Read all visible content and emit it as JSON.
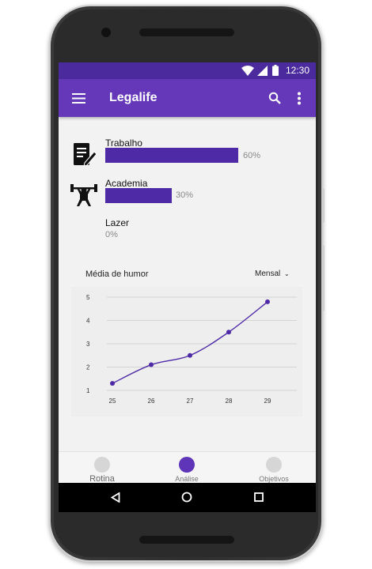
{
  "status_bar": {
    "time": "12:30"
  },
  "app_bar": {
    "title": "Legalife",
    "menu_icon": "hamburger-icon",
    "search_icon": "search-icon",
    "more_icon": "more-vert-icon"
  },
  "categories": [
    {
      "label": "Trabalho",
      "percent_label": "60%",
      "value": 0.6,
      "icon": "document-edit-icon"
    },
    {
      "label": "Academia",
      "percent_label": "30%",
      "value": 0.3,
      "icon": "weightlifter-icon"
    },
    {
      "label": "Lazer",
      "percent_label": "0%",
      "value": 0.0,
      "icon": ""
    }
  ],
  "mood_chart": {
    "title": "Média de humor",
    "period_select": "Mensal",
    "chart_data": {
      "type": "line",
      "x": [
        25,
        26,
        27,
        28,
        29
      ],
      "values": [
        1.3,
        2.1,
        2.5,
        3.5,
        4.8
      ],
      "x_ticks": [
        "25",
        "26",
        "27",
        "28",
        "29"
      ],
      "y_ticks": [
        "1",
        "2",
        "3",
        "4",
        "5"
      ],
      "ylim": [
        1,
        5
      ],
      "grid": true,
      "color": "#4f2aa6"
    }
  },
  "bottom_nav": [
    {
      "label": "Rotina",
      "active": false
    },
    {
      "label": "Análise",
      "active": true
    },
    {
      "label": "Objetivos",
      "active": false
    }
  ],
  "colors": {
    "primary": "#6438b8",
    "primary_dark": "#4a2a9c",
    "bar": "#4f2aa6",
    "active": "#5e34b8"
  }
}
